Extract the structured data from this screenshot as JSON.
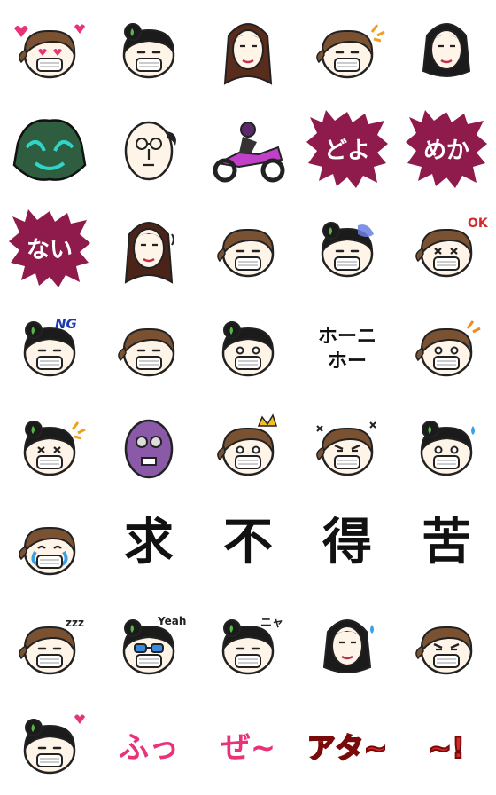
{
  "sheet": {
    "background": "#ffffff",
    "rows": 8,
    "cols": 5
  },
  "colors": {
    "hair": "#1b1b1b",
    "brown_hair": "#7a5232",
    "skin": "#fff4e8",
    "mask": "#ffffff",
    "burst": "#8e1b4c",
    "pink": "#e8337a",
    "red": "#d42a2a",
    "leaf": "#5bb54a",
    "teal": "#2fd6c8",
    "purple_bike": "#c040c8"
  },
  "stickers": [
    {
      "id": 1,
      "icon": "brown-hair-girl-heart-eyes-icon"
    },
    {
      "id": 2,
      "icon": "bun-girl-neutral-icon"
    },
    {
      "id": 3,
      "icon": "long-hair-woman-portrait-icon"
    },
    {
      "id": 4,
      "icon": "ponytail-girl-sparkle-icon"
    },
    {
      "id": 5,
      "icon": "black-hair-woman-smile-icon"
    },
    {
      "id": 6,
      "icon": "green-demon-mask-icon"
    },
    {
      "id": 7,
      "icon": "bald-man-glasses-icon"
    },
    {
      "id": 8,
      "icon": "purple-motorbike-rider-icon"
    },
    {
      "id": 9,
      "icon": "burst-text-doyo-icon",
      "text": "どよ"
    },
    {
      "id": 10,
      "icon": "burst-text-meka-icon",
      "text": "めか"
    },
    {
      "id": 11,
      "icon": "burst-text-nai-icon",
      "text": "ない"
    },
    {
      "id": 12,
      "icon": "long-hair-woman-tired-icon"
    },
    {
      "id": 13,
      "icon": "brown-hair-girl-neutral-icon"
    },
    {
      "id": 14,
      "icon": "bun-girl-cold-icon"
    },
    {
      "id": 15,
      "icon": "brown-hair-girl-ok-icon",
      "text": "OK"
    },
    {
      "id": 16,
      "icon": "bun-girl-ng-icon",
      "text": "NG"
    },
    {
      "id": 17,
      "icon": "brown-hair-girl-plain-icon"
    },
    {
      "id": 18,
      "icon": "bun-girl-sleepy-icon"
    },
    {
      "id": 19,
      "icon": "hoo-hoo-text-icon",
      "text": "ホーニ\nホー"
    },
    {
      "id": 20,
      "icon": "brown-hair-girl-surprised-icon"
    },
    {
      "id": 21,
      "icon": "bun-girl-shout-icon"
    },
    {
      "id": 22,
      "icon": "purple-face-man-icon"
    },
    {
      "id": 23,
      "icon": "brown-hair-girl-crown-icon"
    },
    {
      "id": 24,
      "icon": "brown-hair-girl-angry-icon"
    },
    {
      "id": 25,
      "icon": "bun-girl-sweat-icon"
    },
    {
      "id": 26,
      "icon": "brown-hair-girl-crying-icon"
    },
    {
      "id": 27,
      "icon": "kanji-text-icon",
      "text": "求"
    },
    {
      "id": 28,
      "icon": "kanji-text-icon",
      "text": "不"
    },
    {
      "id": 29,
      "icon": "kanji-text-icon",
      "text": "得"
    },
    {
      "id": 30,
      "icon": "kanji-text-icon",
      "text": "苦"
    },
    {
      "id": 31,
      "icon": "brown-hair-girl-sleep-zzz-icon"
    },
    {
      "id": 32,
      "icon": "bun-girl-sunglasses-yeah-icon",
      "text": "Yeah"
    },
    {
      "id": 33,
      "icon": "bun-girl-nya-icon",
      "text": "ニャ"
    },
    {
      "id": 34,
      "icon": "black-hair-woman-sweat-icon"
    },
    {
      "id": 35,
      "icon": "brown-hair-girl-smug-icon"
    },
    {
      "id": 36,
      "icon": "bun-girl-love-icon"
    },
    {
      "id": 37,
      "icon": "pink-text-fu-icon",
      "text": "ふっ"
    },
    {
      "id": 38,
      "icon": "pink-text-ze-icon",
      "text": "ぜ~"
    },
    {
      "id": 39,
      "icon": "red-text-ata-icon",
      "text": "アタ~"
    },
    {
      "id": 40,
      "icon": "red-text-exclaim-icon",
      "text": "~!"
    }
  ]
}
